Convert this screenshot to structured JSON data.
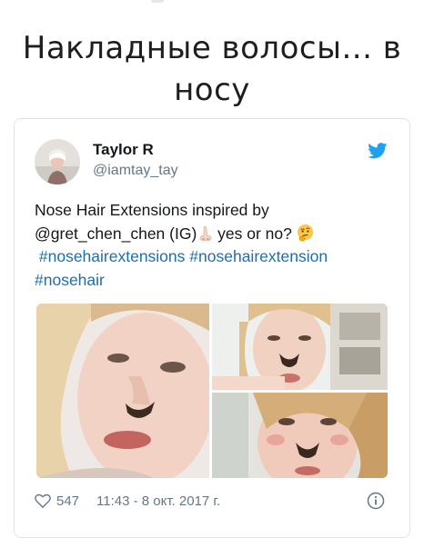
{
  "article": {
    "headline_line1": "Накладные волосы... в",
    "headline_line2": "носу"
  },
  "tweet": {
    "author_name": "Taylor R",
    "author_handle": "@iamtay_tay",
    "text_line1": "Nose Hair Extensions inspired by",
    "text_line2_mention": "@gret_chen_chen (IG)",
    "text_line2_after": "yes or no?",
    "hashtags": [
      "#nosehairextensions",
      "#nosehairextension",
      "#nosehair"
    ],
    "emojis": [
      "nose-emoji",
      "thinking-face-emoji"
    ],
    "images": [
      "photo-woman-nose-hair-closeup",
      "photo-woman-nose-hair-portrait",
      "photo-woman-nose-hair-selfie"
    ],
    "likes": "547",
    "timestamp": "11:43 - 8 окт. 2017 г.",
    "icons": [
      "twitter-bird-icon",
      "heart-icon",
      "info-icon"
    ]
  },
  "colors": {
    "link": "#1b6fae",
    "twitter_blue": "#1da1f2",
    "muted": "#657786"
  }
}
